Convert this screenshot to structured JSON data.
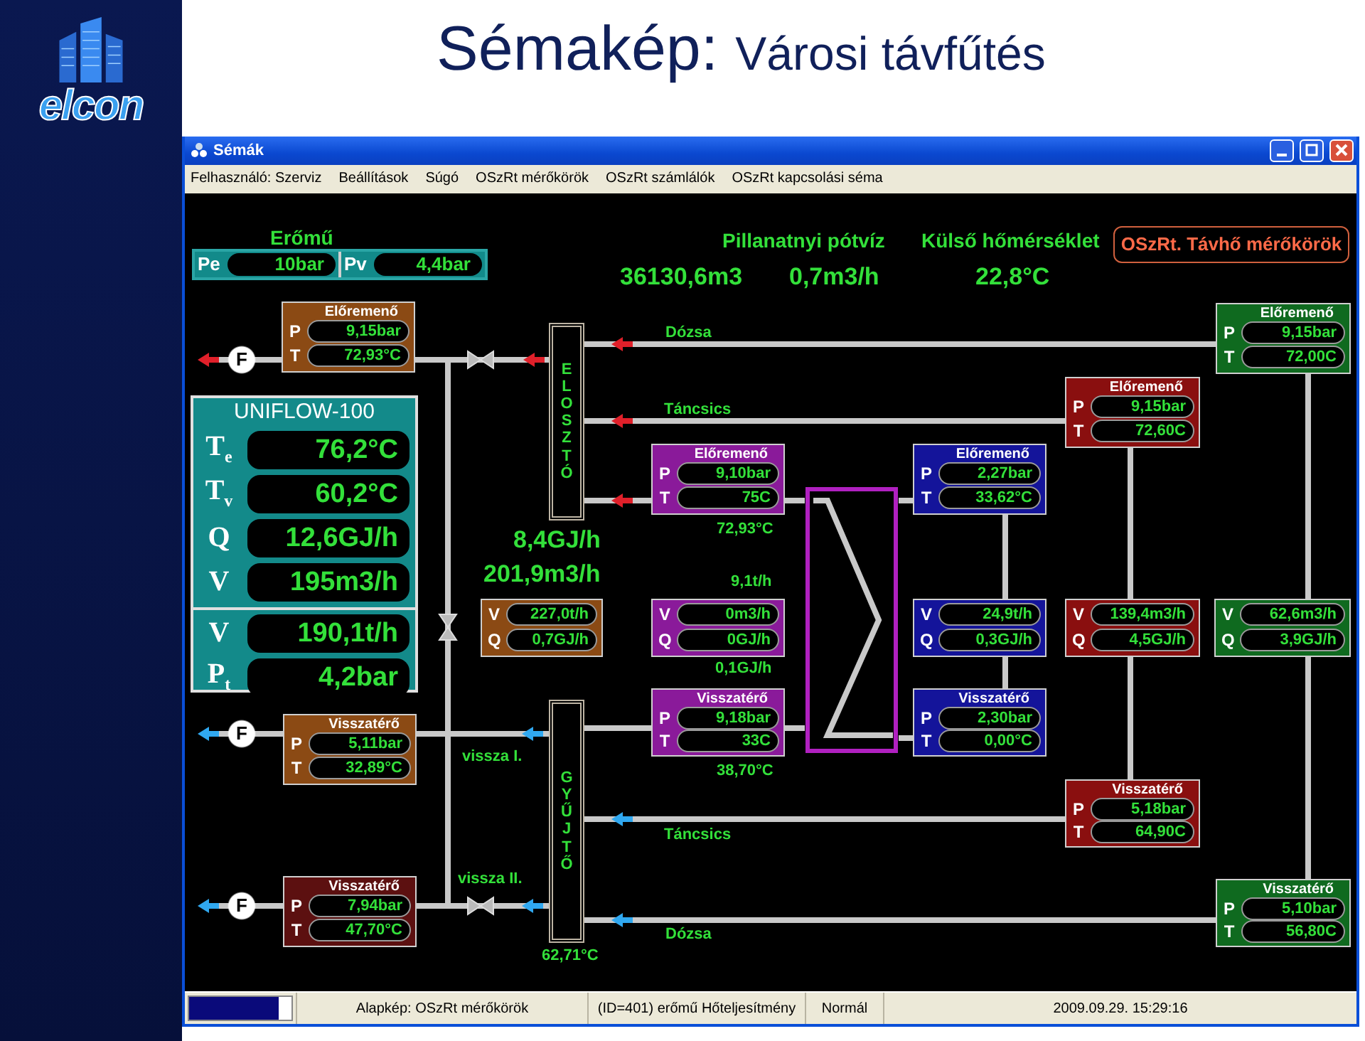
{
  "slide": {
    "logo": "elcon",
    "title": "Sémakép:",
    "subtitle": "Városi távfűtés"
  },
  "window": {
    "title": "Sémák"
  },
  "menu": [
    "Felhasználó: Szerviz",
    "Beállítások",
    "Súgó",
    "OSzRt mérőkörök",
    "OSzRt számlálók",
    "OSzRt kapcsolási séma"
  ],
  "power_plant": {
    "title": "Erőmű",
    "fields": [
      {
        "label": "Pe",
        "value": "10bar"
      },
      {
        "label": "Pv",
        "value": "4,4bar"
      }
    ]
  },
  "makeup_water": {
    "title": "Pillanatnyi pótvíz",
    "values": [
      "36130,6m3",
      "0,7m3/h"
    ]
  },
  "outdoor": {
    "title": "Külső hőmérséklet",
    "value": "22,8°C"
  },
  "circuits_button": "OSzRt. Távhő mérőkörök",
  "uniflow": {
    "title": "UNIFLOW-100",
    "sections": [
      [
        {
          "symbol": "T$_{e}$",
          "value": "76,2°C"
        },
        {
          "symbol": "T$_{v}$",
          "value": "60,2°C"
        },
        {
          "symbol": "Q",
          "value": "12,6GJ/h"
        },
        {
          "symbol": "V",
          "value": "195m3/h"
        }
      ],
      [
        {
          "symbol": "V",
          "value": "190,1t/h"
        },
        {
          "symbol": "P$_{t}$",
          "value": "4,2bar"
        }
      ]
    ]
  },
  "headers": [
    {
      "text": "ELOSZTÓ"
    },
    {
      "text": "GYŰJTŐ"
    }
  ],
  "meters": [
    {
      "kind": "pt",
      "color": "#8b4a14",
      "heading": "Előremenő",
      "rows": [
        {
          "label": "P",
          "value": "9,15bar"
        },
        {
          "label": "T",
          "value": "72,93°C"
        }
      ]
    },
    {
      "kind": "pt",
      "color": "#0f6a1f",
      "heading": "Előremenő",
      "rows": [
        {
          "label": "P",
          "value": "9,15bar"
        },
        {
          "label": "T",
          "value": "72,00C"
        }
      ]
    },
    {
      "kind": "pt",
      "color": "#8a0f0f",
      "heading": "Előremenő",
      "rows": [
        {
          "label": "P",
          "value": "9,15bar"
        },
        {
          "label": "T",
          "value": "72,60C"
        }
      ]
    },
    {
      "kind": "pt",
      "color": "#8a1a9a",
      "heading": "Előremenő",
      "rows": [
        {
          "label": "P",
          "value": "9,10bar"
        },
        {
          "label": "T",
          "value": "75C"
        }
      ]
    },
    {
      "kind": "pt",
      "color": "#14149a",
      "heading": "Előremenő",
      "rows": [
        {
          "label": "P",
          "value": "2,27bar"
        },
        {
          "label": "T",
          "value": "33,62°C"
        }
      ]
    },
    {
      "kind": "vq",
      "color": "#8b4a14",
      "rows": [
        {
          "label": "V",
          "value": "227,0t/h"
        },
        {
          "label": "Q",
          "value": "0,7GJ/h"
        }
      ]
    },
    {
      "kind": "vq",
      "color": "#8a1a9a",
      "rows": [
        {
          "label": "V",
          "value": "0m3/h"
        },
        {
          "label": "Q",
          "value": "0GJ/h"
        }
      ]
    },
    {
      "kind": "vq",
      "color": "#14149a",
      "rows": [
        {
          "label": "V",
          "value": "24,9t/h"
        },
        {
          "label": "Q",
          "value": "0,3GJ/h"
        }
      ]
    },
    {
      "kind": "vq",
      "color": "#8a0f0f",
      "rows": [
        {
          "label": "V",
          "value": "139,4m3/h"
        },
        {
          "label": "Q",
          "value": "4,5GJ/h"
        }
      ]
    },
    {
      "kind": "vq",
      "color": "#0f6a1f",
      "rows": [
        {
          "label": "V",
          "value": "62,6m3/h"
        },
        {
          "label": "Q",
          "value": "3,9GJ/h"
        }
      ]
    },
    {
      "kind": "pt",
      "color": "#8b4a14",
      "heading": "Visszatérő",
      "rows": [
        {
          "label": "P",
          "value": "5,11bar"
        },
        {
          "label": "T",
          "value": "32,89°C"
        }
      ]
    },
    {
      "kind": "pt",
      "color": "#8a1a9a",
      "heading": "Visszatérő",
      "rows": [
        {
          "label": "P",
          "value": "9,18bar"
        },
        {
          "label": "T",
          "value": "33C"
        }
      ]
    },
    {
      "kind": "pt",
      "color": "#14149a",
      "heading": "Visszatérő",
      "rows": [
        {
          "label": "P",
          "value": "2,30bar"
        },
        {
          "label": "T",
          "value": "0,00°C"
        }
      ]
    },
    {
      "kind": "pt",
      "color": "#8a0f0f",
      "heading": "Visszatérő",
      "rows": [
        {
          "label": "P",
          "value": "5,18bar"
        },
        {
          "label": "T",
          "value": "64,90C"
        }
      ]
    },
    {
      "kind": "pt",
      "color": "#5c1010",
      "heading": "Visszatérő",
      "rows": [
        {
          "label": "P",
          "value": "7,94bar"
        },
        {
          "label": "T",
          "value": "47,70°C"
        }
      ]
    },
    {
      "kind": "pt",
      "color": "#0f6a1f",
      "heading": "Visszatérő",
      "rows": [
        {
          "label": "P",
          "value": "5,10bar"
        },
        {
          "label": "T",
          "value": "56,80C"
        }
      ]
    }
  ],
  "labels": [
    {
      "kind": "note",
      "text": "Dózsa"
    },
    {
      "kind": "note",
      "text": "Táncsics"
    },
    {
      "kind": "note",
      "text": "72,93°C"
    },
    {
      "kind": "total",
      "text": "8,4GJ/h"
    },
    {
      "kind": "total",
      "text": "201,9m3/h"
    },
    {
      "kind": "note",
      "text": "9,1t/h"
    },
    {
      "kind": "note",
      "text": "0,1GJ/h"
    },
    {
      "kind": "note",
      "text": "vissza I."
    },
    {
      "kind": "note",
      "text": "38,70°C"
    },
    {
      "kind": "note",
      "text": "Táncsics"
    },
    {
      "kind": "note",
      "text": "vissza II."
    },
    {
      "kind": "note",
      "text": "Dózsa"
    },
    {
      "kind": "note",
      "text": "62,71°C"
    }
  ],
  "flow_meters": [
    {
      "label": "F"
    },
    {
      "label": "F"
    },
    {
      "label": "F"
    }
  ],
  "status_bar": {
    "level": 0.88,
    "texts": [
      "Alapkép: OSzRt mérőkörök",
      "(ID=401) erőmű Hőteljesítmény",
      "Normál",
      "2009.09.29. 15:29:16"
    ]
  }
}
